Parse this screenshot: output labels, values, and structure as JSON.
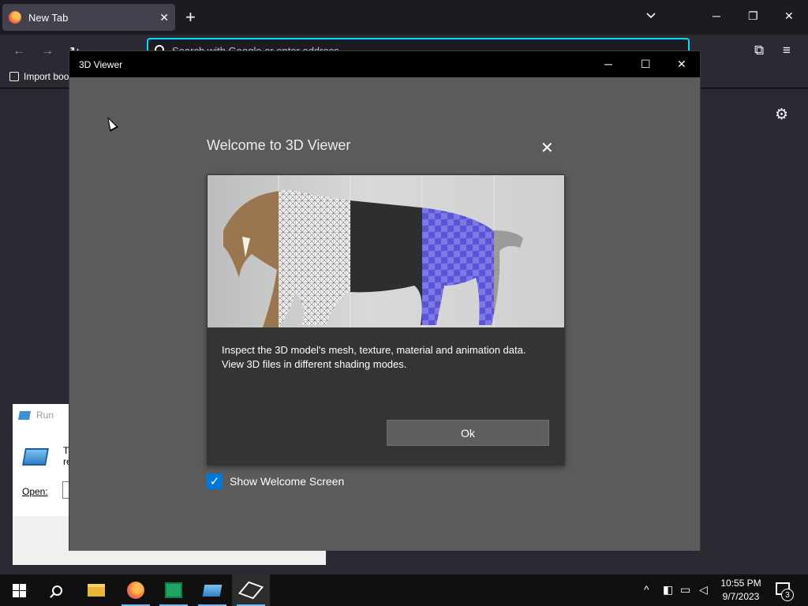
{
  "browser": {
    "tab": {
      "title": "New Tab",
      "close_glyph": "✕"
    },
    "new_tab_glyph": "+",
    "window_controls": {
      "minimize": "─",
      "restore": "❐",
      "close": "✕"
    },
    "nav": {
      "back": "←",
      "forward": "→",
      "reload": "↻"
    },
    "urlbar": {
      "placeholder": "Search with Google or enter address",
      "value": ""
    },
    "toolbar_right": {
      "extensions": "⧉",
      "menu": "≡"
    },
    "bookmarks": {
      "import_label": "Import boo"
    },
    "settings_glyph": "⚙"
  },
  "run_dialog": {
    "title": "Run",
    "body_text_line1": "Ty",
    "body_text_line2": "re",
    "open_label": "Open:",
    "open_value": ""
  },
  "viewer": {
    "window_title": "3D Viewer",
    "controls": {
      "minimize": "─",
      "maximize": "☐",
      "close": "✕"
    },
    "welcome": {
      "title": "Welcome to 3D Viewer",
      "close_glyph": "✕",
      "description_line1": "Inspect the 3D model's mesh, texture, material and animation data.",
      "description_line2": "View 3D files in different shading modes.",
      "ok_label": "Ok",
      "show_welcome_label": "Show Welcome Screen",
      "show_welcome_checked": true,
      "check_glyph": "✓"
    }
  },
  "taskbar": {
    "clock_time": "10:55 PM",
    "clock_date": "9/7/2023",
    "notification_count": "3",
    "tray": {
      "chevron": "^",
      "meet": "◧",
      "network": "▭",
      "volume": "◁"
    },
    "active_app": "3d-viewer"
  },
  "colors": {
    "accent": "#0078d7",
    "urlbar_focus": "#00ddff",
    "viewer_bg": "#5a5b5c",
    "card_bg": "#333434"
  }
}
